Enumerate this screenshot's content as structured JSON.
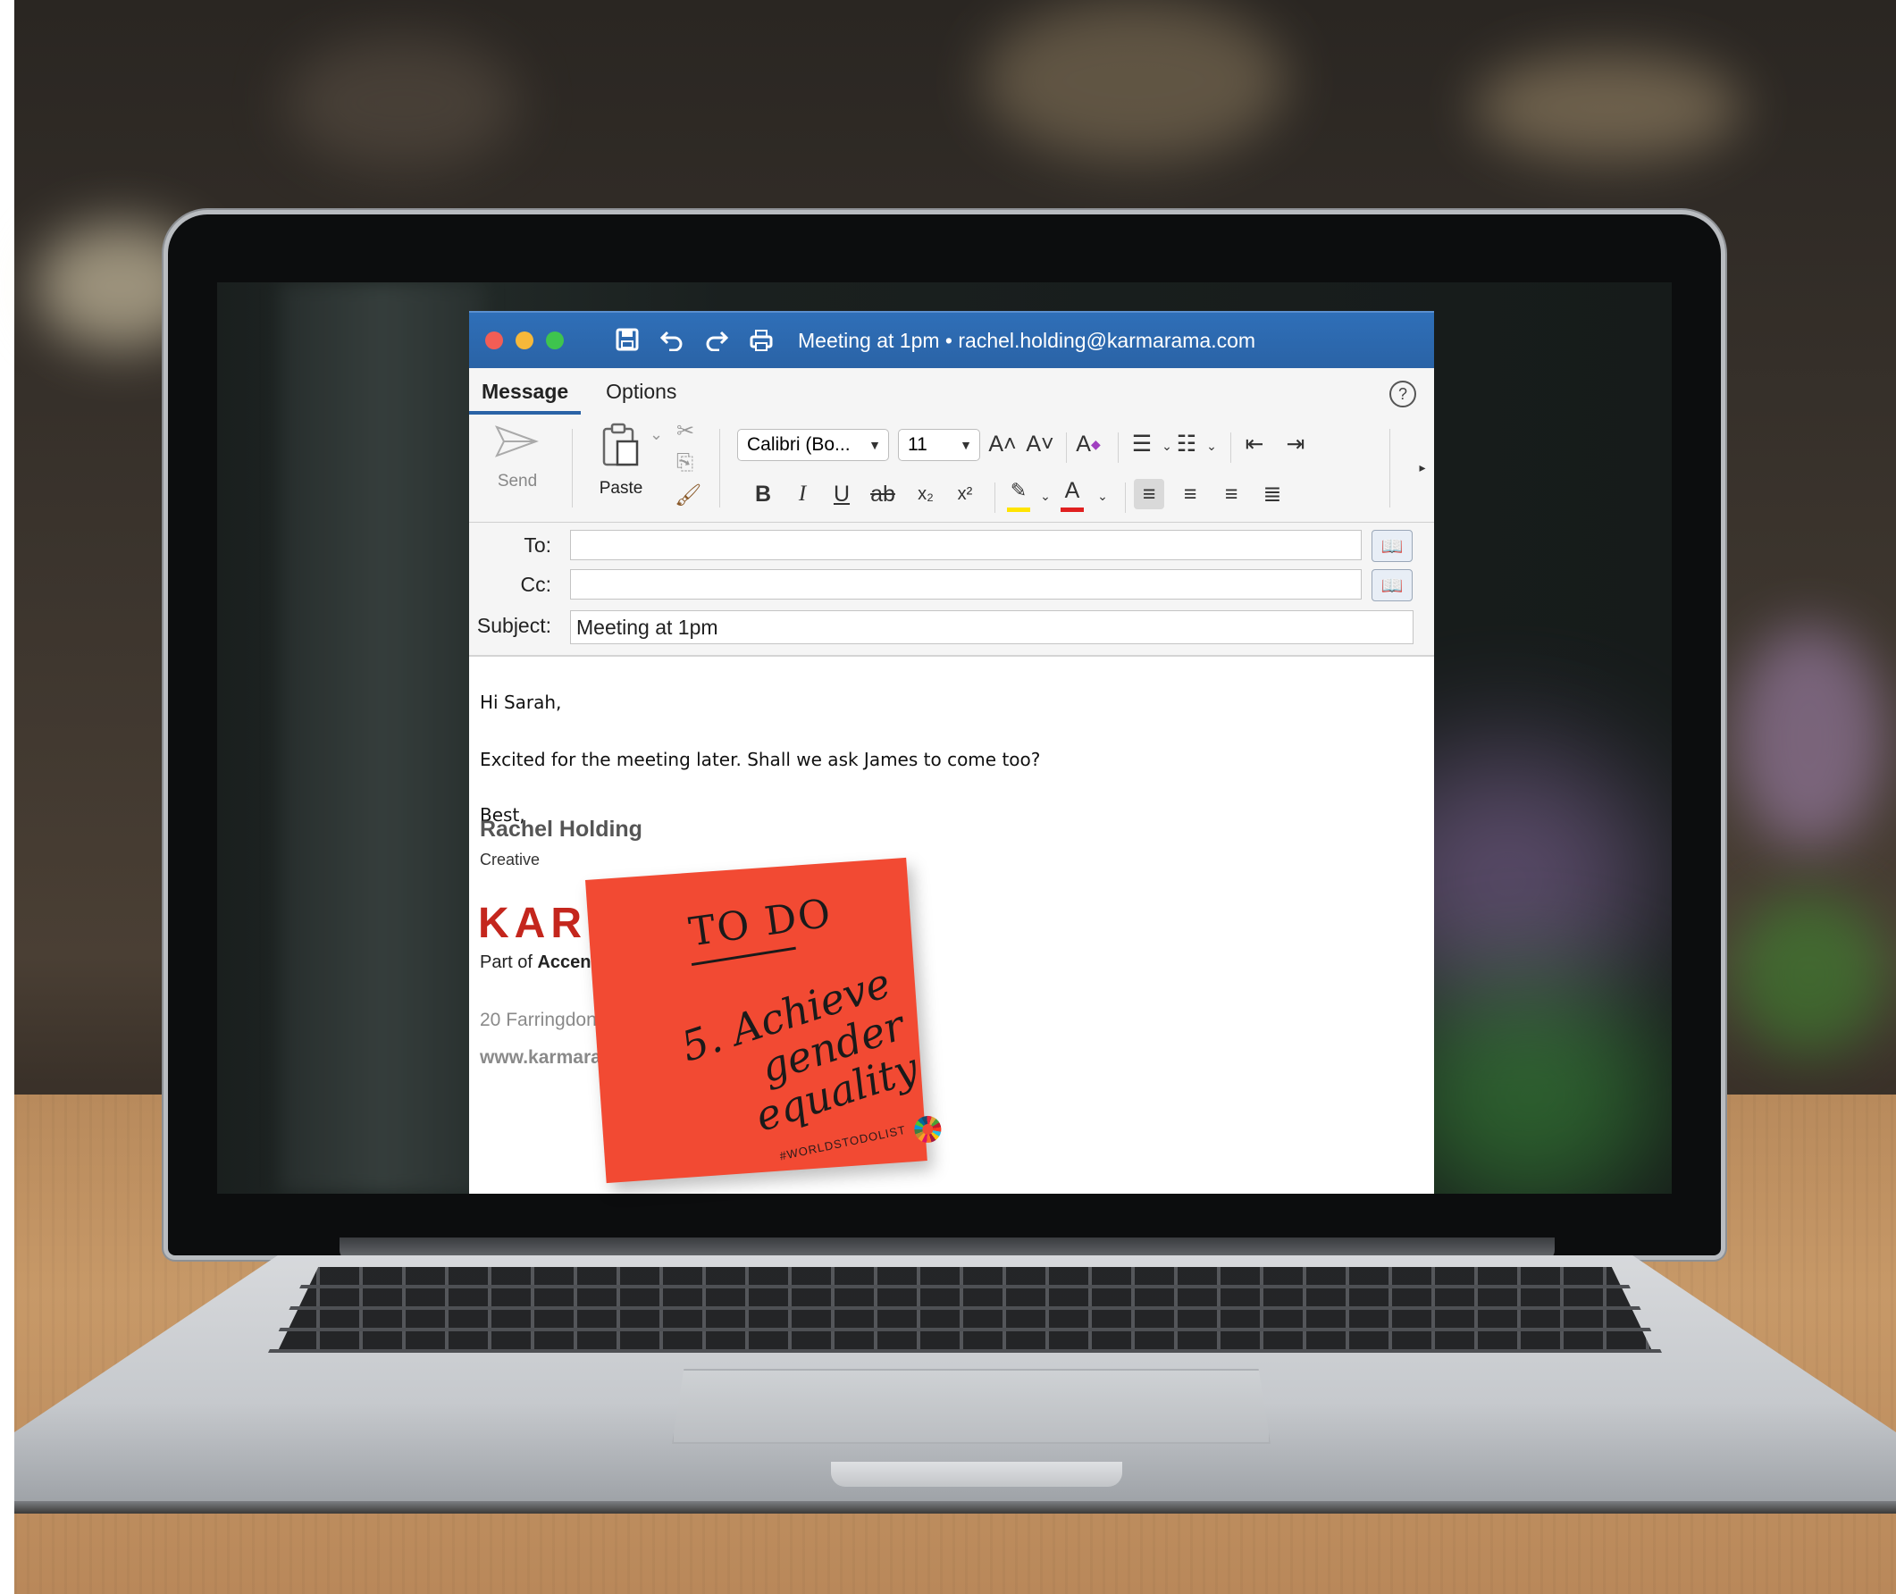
{
  "window": {
    "title": "Meeting at 1pm • rachel.holding@karmarama.com"
  },
  "titlebar_icons": [
    "save-icon",
    "undo-icon",
    "redo-icon",
    "print-icon"
  ],
  "tabs": [
    {
      "label": "Message",
      "active": true
    },
    {
      "label": "Options",
      "active": false
    }
  ],
  "ribbon": {
    "send_label": "Send",
    "paste_label": "Paste",
    "font_name": "Calibri (Bo...",
    "font_size": "11",
    "bold": "B",
    "italic": "I",
    "underline": "U",
    "strikethrough": "ab",
    "subscript": "x₂",
    "superscript": "x²",
    "grow_font": "A˄",
    "shrink_font": "A˅",
    "font_color": "A",
    "highlight_color": "#ffe400",
    "text_color": "#e02020"
  },
  "fields": {
    "to_label": "To:",
    "to_value": "",
    "cc_label": "Cc:",
    "cc_value": "",
    "subject_label": "Subject:",
    "subject_value": "Meeting at 1pm"
  },
  "body": {
    "greeting": "Hi Sarah,",
    "message": "Excited for the meeting later. Shall we ask James to come too?",
    "closing": "Best,"
  },
  "signature": {
    "name": "Rachel Holding",
    "role": "Creative",
    "logo_text": "KARM",
    "part_of_prefix": "Part of ",
    "part_of_brand": "Accent",
    "address": "20 Farringdon",
    "website": "www.karmara"
  },
  "sticky_note": {
    "heading": "TO DO",
    "goal": "5. Achieve gender equality",
    "hashtag": "#WORLDSTODOLIST",
    "color": "#f24a33"
  },
  "colors": {
    "titlebar": "#2a63a6",
    "logo_red": "#c4261d"
  }
}
